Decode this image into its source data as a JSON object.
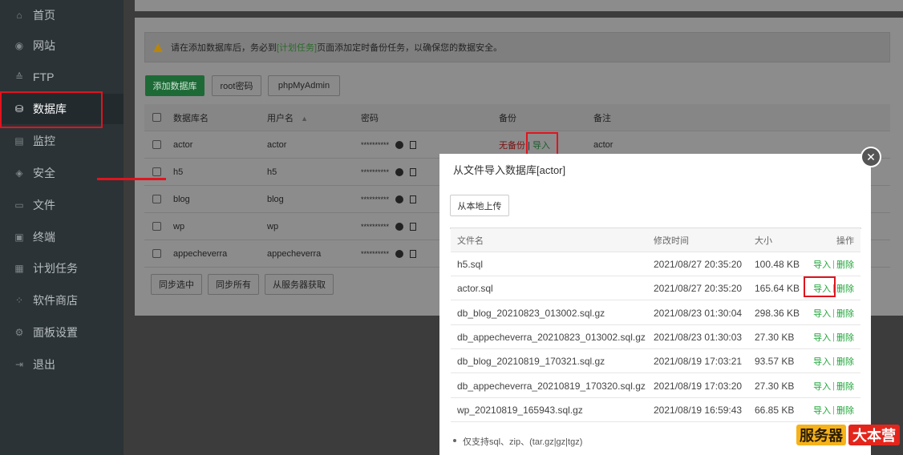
{
  "sidebar": {
    "items": [
      {
        "label": "首页",
        "icon": "home-icon",
        "glyph": "⌂"
      },
      {
        "label": "网站",
        "icon": "globe-icon",
        "glyph": "◉"
      },
      {
        "label": "FTP",
        "icon": "ftp-icon",
        "glyph": "≙"
      },
      {
        "label": "数据库",
        "icon": "database-icon",
        "glyph": "⛁"
      },
      {
        "label": "监控",
        "icon": "monitor-icon",
        "glyph": "▤"
      },
      {
        "label": "安全",
        "icon": "shield-icon",
        "glyph": "◈"
      },
      {
        "label": "文件",
        "icon": "folder-icon",
        "glyph": "▭"
      },
      {
        "label": "终端",
        "icon": "terminal-icon",
        "glyph": "▣"
      },
      {
        "label": "计划任务",
        "icon": "calendar-icon",
        "glyph": "▦"
      },
      {
        "label": "软件商店",
        "icon": "apps-icon",
        "glyph": "⁘"
      },
      {
        "label": "面板设置",
        "icon": "gear-icon",
        "glyph": "⚙"
      },
      {
        "label": "退出",
        "icon": "logout-icon",
        "glyph": "⇥"
      }
    ]
  },
  "notice": {
    "before": "请在添加数据库后，务必到",
    "link": "[计划任务]",
    "after": "页面添加定时备份任务，以确保您的数据安全。"
  },
  "toolbar": {
    "add_db": "添加数据库",
    "root_pw": "root密码",
    "phpmyadmin": "phpMyAdmin"
  },
  "db_table": {
    "headers": {
      "name": "数据库名",
      "user": "用户名",
      "password": "密码",
      "backup": "备份",
      "note": "备注"
    },
    "sort_arrow": "▲",
    "rows": [
      {
        "name": "actor",
        "user": "actor",
        "password": "**********",
        "backup_status": "无备份",
        "backup_sep": " | ",
        "backup_import": "导入",
        "note": "actor"
      },
      {
        "name": "h5",
        "user": "h5",
        "password": "**********"
      },
      {
        "name": "blog",
        "user": "blog",
        "password": "**********"
      },
      {
        "name": "wp",
        "user": "wp",
        "password": "**********"
      },
      {
        "name": "appecheverra",
        "user": "appecheverra",
        "password": "**********"
      }
    ]
  },
  "bottom_buttons": {
    "sync_selected": "同步选中",
    "sync_all": "同步所有",
    "from_server": "从服务器获取"
  },
  "modal": {
    "title": "从文件导入数据库[actor]",
    "close": "✕",
    "upload_button": "从本地上传",
    "headers": {
      "name": "文件名",
      "time": "修改时间",
      "size": "大小",
      "ops": "操作"
    },
    "op_import": "导入",
    "op_sep": "|",
    "op_delete": "删除",
    "files": [
      {
        "name": "h5.sql",
        "time": "2021/08/27 20:35:20",
        "size": "100.48 KB"
      },
      {
        "name": "actor.sql",
        "time": "2021/08/27 20:35:20",
        "size": "165.64 KB"
      },
      {
        "name": "db_blog_20210823_013002.sql.gz",
        "time": "2021/08/23 01:30:04",
        "size": "298.36 KB"
      },
      {
        "name": "db_appecheverra_20210823_013002.sql.gz",
        "time": "2021/08/23 01:30:03",
        "size": "27.30 KB"
      },
      {
        "name": "db_blog_20210819_170321.sql.gz",
        "time": "2021/08/19 17:03:21",
        "size": "93.57 KB"
      },
      {
        "name": "db_appecheverra_20210819_170320.sql.gz",
        "time": "2021/08/19 17:03:20",
        "size": "27.30 KB"
      },
      {
        "name": "wp_20210819_165943.sql.gz",
        "time": "2021/08/19 16:59:43",
        "size": "66.85 KB"
      }
    ],
    "tip": "仅支持sql、zip、(tar.gz|gz|tgz)"
  },
  "watermark": {
    "part1": "服务器",
    "part2": "大本营"
  },
  "colors": {
    "sidebar_bg": "#2b3336",
    "accent_green": "#20a53a",
    "highlight_red": "#e0141e"
  }
}
